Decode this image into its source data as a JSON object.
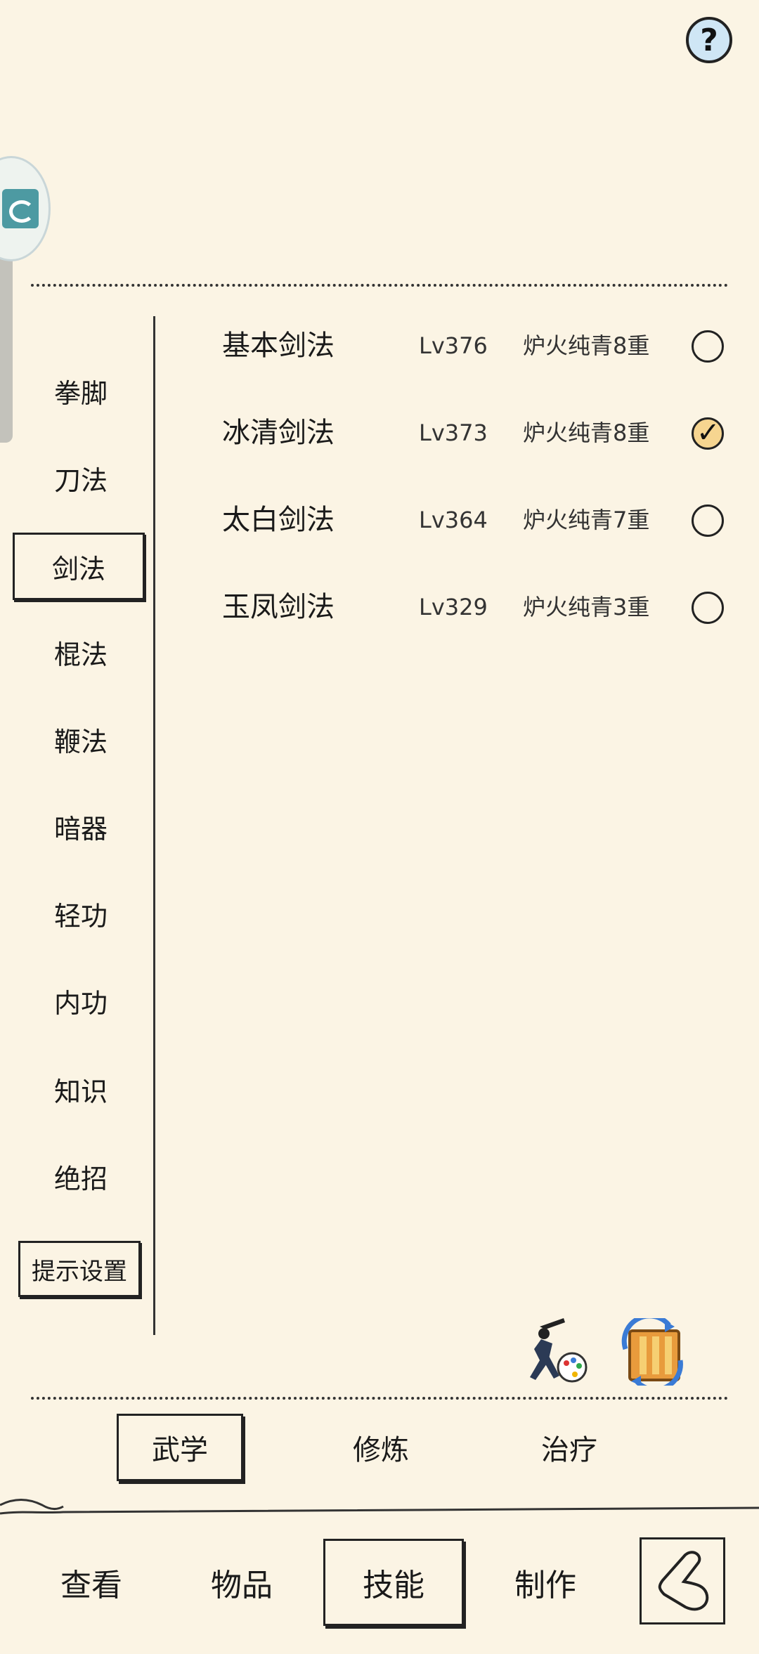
{
  "help": {
    "label": "?"
  },
  "categories": [
    {
      "label": "拳脚"
    },
    {
      "label": "刀法"
    },
    {
      "label": "剑法",
      "active": true
    },
    {
      "label": "棍法"
    },
    {
      "label": "鞭法"
    },
    {
      "label": "暗器"
    },
    {
      "label": "轻功"
    },
    {
      "label": "内功"
    },
    {
      "label": "知识"
    },
    {
      "label": "绝招"
    }
  ],
  "hint_setting": {
    "label": "提示设置"
  },
  "skills": [
    {
      "name": "基本剑法",
      "level": "Lv376",
      "tier": "炉火纯青8重",
      "checked": false
    },
    {
      "name": "冰清剑法",
      "level": "Lv373",
      "tier": "炉火纯青8重",
      "checked": true
    },
    {
      "name": "太白剑法",
      "level": "Lv364",
      "tier": "炉火纯青7重",
      "checked": false
    },
    {
      "name": "玉凤剑法",
      "level": "Lv329",
      "tier": "炉火纯青3重",
      "checked": false
    }
  ],
  "action_icons": [
    "warrior-palette-icon",
    "scroll-swap-icon"
  ],
  "subtabs": [
    {
      "label": "武学",
      "active": true
    },
    {
      "label": "修炼"
    },
    {
      "label": "治疗"
    }
  ],
  "nav": [
    {
      "label": "查看"
    },
    {
      "label": "物品"
    },
    {
      "label": "技能",
      "active": true
    },
    {
      "label": "制作"
    }
  ],
  "back_icon": "back-arrow-icon",
  "colors": {
    "background": "#fbf4e4",
    "checked_fill": "#f6d590",
    "help_fill": "#cfe6f5"
  }
}
